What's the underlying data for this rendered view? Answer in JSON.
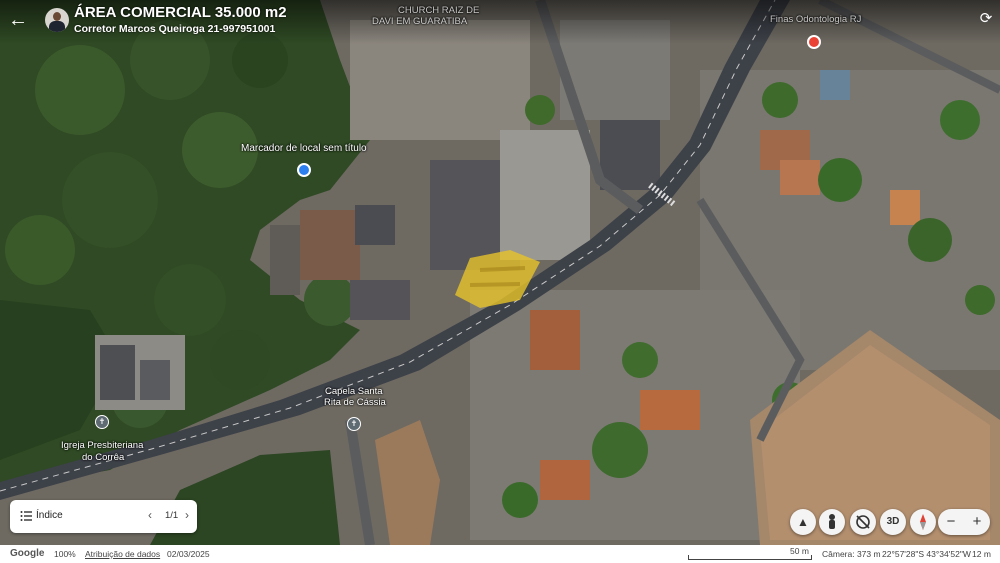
{
  "header": {
    "title": "ÁREA COMERCIAL 35.000 m2",
    "subtitle": "Corretor Marcos Queiroga 21-997951001"
  },
  "map_labels": {
    "church_top": "CHURCH RAIZ DE",
    "church_top2": "DAVI EM GUARATIBA",
    "dental": "Finas Odontologia RJ",
    "marker": "Marcador de local sem título",
    "capela": "Capela Santa",
    "capela2": "Rita de Cássia",
    "igreja": "Igreja Presbiteriana",
    "igreja2": "do Corrêa"
  },
  "index_card": {
    "label": "Índice",
    "count": "1/1"
  },
  "controls": {
    "threed": "3D"
  },
  "footer": {
    "logo": "Google",
    "zoom": "100%",
    "attribution": "Atribuição de dados",
    "date": "02/03/2025",
    "scale": "50 m",
    "camera": "Câmera: 373 m",
    "coords": "22°57'28\"S 43°34'52\"W",
    "elevation": "12 m"
  },
  "colors": {
    "marker_blue": "#2d7ff0",
    "poi_red": "#ea4335",
    "road": "#3d4148"
  }
}
